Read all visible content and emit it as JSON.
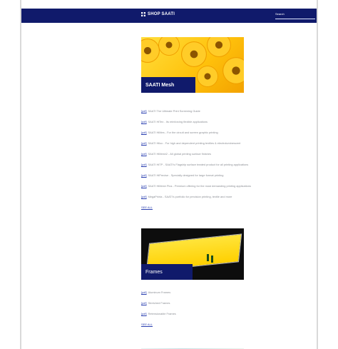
{
  "header": {
    "brand": "SHOP SAATI",
    "search_placeholder": "Search"
  },
  "sections": [
    {
      "caption": "SAATI Mesh",
      "links": [
        {
          "tag": "[pdf]",
          "text": "SAATI The Ultimate Print Screening Guide"
        },
        {
          "tag": "[pdf]",
          "text": "SAATI HiTex - Its reinforcing flexible applications"
        },
        {
          "tag": "[pdf]",
          "text": "SAATI HiMes - For the circuit and screen graphic printing"
        },
        {
          "tag": "[pdf]",
          "text": "SAATI Hiloc - For high and dependent printing textiles & electroluminescent"
        },
        {
          "tag": "[pdf]",
          "text": "SAATI HiMesh2 - All global printing surface finishes"
        },
        {
          "tag": "[pdf]",
          "text": "SAATI HiTP - SAATI's Flagship surface treated product for all printing applications"
        },
        {
          "tag": "[pdf]",
          "text": "SAATI HiPrecise - Specially designed for large format printing"
        },
        {
          "tag": "[pdf]",
          "text": "SAATI HiMesh Plus - Premium offering for the most demanding printing applications"
        },
        {
          "tag": "[pdf]",
          "text": "MegaPrinta - SAATI's portfolio for precision printing, textile and more"
        }
      ],
      "see_all": "SEE ALL"
    },
    {
      "caption": "Frames",
      "links": [
        {
          "tag": "[pdf]",
          "text": "Aluminum Frames"
        },
        {
          "tag": "[pdf]",
          "text": "Stretched Frames"
        },
        {
          "tag": "[pdf]",
          "text": "Retensionable Frames"
        }
      ],
      "see_all": "SEE ALL"
    }
  ]
}
